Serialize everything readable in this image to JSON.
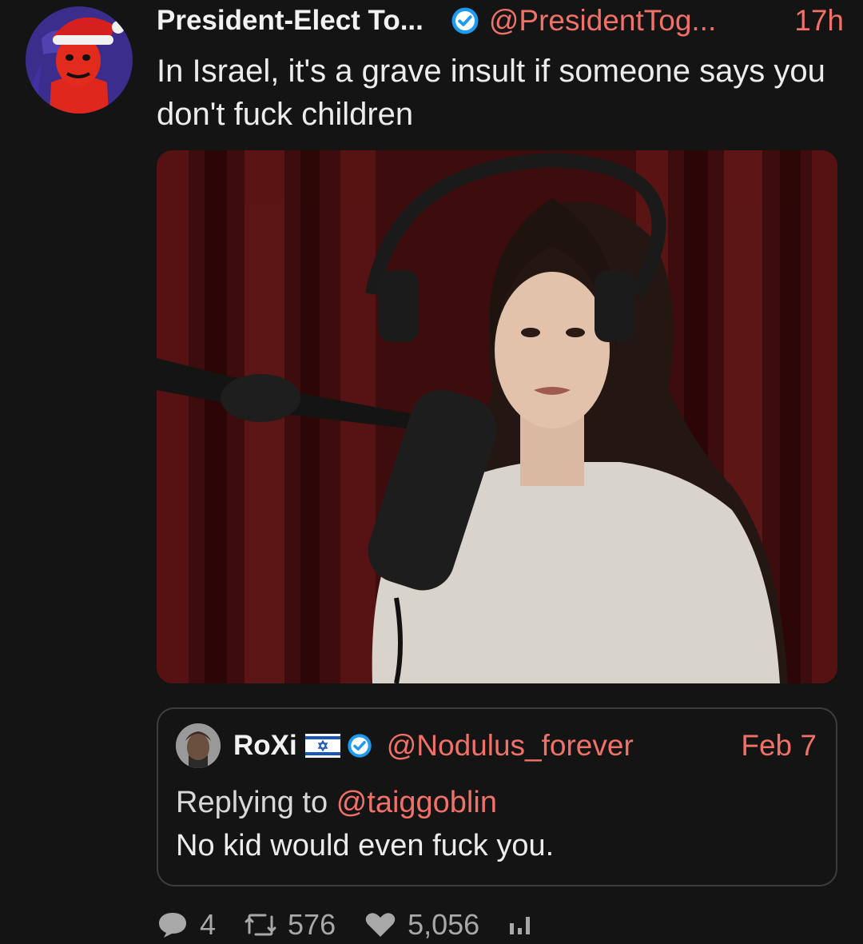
{
  "tweet": {
    "display_name": "President-Elect To...",
    "handle": "@PresidentTog...",
    "time": "17h",
    "text": "In Israel, it's a grave insult if someone says you don't fuck children",
    "avatar_icon": "santa-hat-avatar",
    "verified_icon": "verified-badge-icon"
  },
  "quote": {
    "display_name": "RoXi",
    "flag_icon": "israel-flag-icon",
    "handle": "@Nodulus_forever",
    "date": "Feb 7",
    "reply_prefix": "Replying to",
    "reply_handle": "@taiggoblin",
    "text": "No kid would even fuck you."
  },
  "actions": {
    "replies": "4",
    "retweets": "576",
    "likes": "5,056"
  },
  "colors": {
    "background": "#141414",
    "accent": "#f07167",
    "verified": "#1d9bf0",
    "border": "#3d3d3d"
  }
}
